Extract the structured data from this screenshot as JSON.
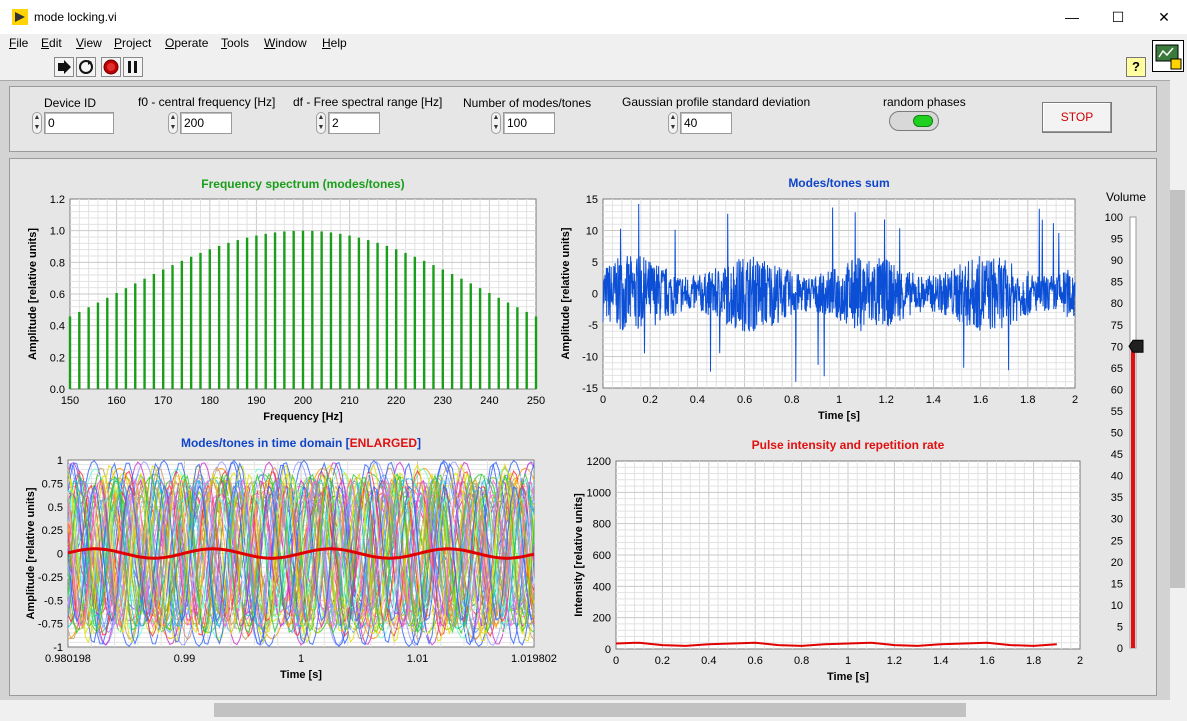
{
  "window": {
    "title": "mode locking.vi",
    "buttons": {
      "minimize": "—",
      "maximize": "☐",
      "close": "✕"
    }
  },
  "menu": {
    "items": [
      {
        "label": "File",
        "hotkey": "F",
        "rest": "ile"
      },
      {
        "label": "Edit",
        "hotkey": "E",
        "rest": "dit"
      },
      {
        "label": "View",
        "hotkey": "V",
        "rest": "iew"
      },
      {
        "label": "Project",
        "hotkey": "P",
        "rest": "roject"
      },
      {
        "label": "Operate",
        "hotkey": "O",
        "rest": "perate"
      },
      {
        "label": "Tools",
        "hotkey": "T",
        "rest": "ools"
      },
      {
        "label": "Window",
        "hotkey": "W",
        "rest": "indow"
      },
      {
        "label": "Help",
        "hotkey": "H",
        "rest": "elp"
      }
    ]
  },
  "toolbar": {
    "help_label": "?",
    "icons": [
      "run-arrow-icon",
      "run-continuously-icon",
      "abort-icon",
      "pause-icon"
    ]
  },
  "controls": {
    "device_id": {
      "label": "Device ID",
      "value": "0"
    },
    "f0": {
      "label": "f0 - central frequency [Hz]",
      "value": "200"
    },
    "df": {
      "label": "df - Free spectral range [Hz]",
      "value": "2"
    },
    "modes": {
      "label": "Number of modes/tones",
      "value": "100"
    },
    "gauss": {
      "label": "Gaussian profile standard deviation",
      "value": "40"
    },
    "random_phases": {
      "label": "random phases",
      "state": "on"
    },
    "stop_label": "STOP",
    "spinner_up": "▲",
    "spinner_down": "▼"
  },
  "colors": {
    "green": "#1a9e1a",
    "blue": "#1045c8",
    "red": "#e01010",
    "trace_blue": "#0b4fd6",
    "trace_red": "#e00000"
  },
  "chart_data": [
    {
      "id": "spectrum",
      "type": "bar",
      "title": "Frequency spectrum (modes/tones)",
      "xlabel": "Frequency [Hz]",
      "ylabel": "Amplitude [relative units]",
      "xlim": [
        150,
        250
      ],
      "ylim": [
        0,
        1.2
      ],
      "xticks": [
        "150",
        "160",
        "170",
        "180",
        "190",
        "200",
        "210",
        "220",
        "230",
        "240",
        "250"
      ],
      "yticks": [
        "0.0",
        "0.2",
        "0.4",
        "0.6",
        "0.8",
        "1.0",
        "1.2"
      ],
      "bar_color": "#1a9e1a",
      "f0": 200,
      "df": 2,
      "n_modes": 51,
      "sigma": 40,
      "grid": true
    },
    {
      "id": "sum",
      "type": "line",
      "title": "Modes/tones sum",
      "xlabel": "Time [s]",
      "ylabel": "Amplitude [relative units]",
      "xlim": [
        0,
        2
      ],
      "ylim": [
        -15,
        15
      ],
      "xticks": [
        "0",
        "0.2",
        "0.4",
        "0.6",
        "0.8",
        "1",
        "1.2",
        "1.4",
        "1.6",
        "1.8",
        "2"
      ],
      "yticks": [
        "-15",
        "-10",
        "-5",
        "0",
        "5",
        "10",
        "15"
      ],
      "line_color": "#0b4fd6",
      "grid": true
    },
    {
      "id": "time_domain",
      "type": "line",
      "title_main": "Modes/tones in time domain [",
      "title_emph": "ENLARGED",
      "title_end": "]",
      "xlabel": "Time [s]",
      "ylabel": "Amplitude [relative units]",
      "xlim": [
        0.980198,
        1.019802
      ],
      "ylim": [
        -1,
        1
      ],
      "xticks": [
        "0.980198",
        "0.99",
        "1",
        "1.01",
        "1.019802"
      ],
      "yticks": [
        "-1",
        "-0.75",
        "-0.5",
        "-0.25",
        "0",
        "0.25",
        "0.5",
        "0.75",
        "1"
      ],
      "highlight_color": "#e00000",
      "grid": true
    },
    {
      "id": "intensity",
      "type": "line",
      "title": "Pulse intensity and repetition rate",
      "xlabel": "Time [s]",
      "ylabel": "Intensity [relative units]",
      "xlim": [
        0,
        2
      ],
      "ylim": [
        0,
        1200
      ],
      "xticks": [
        "0",
        "0.2",
        "0.4",
        "0.6",
        "0.8",
        "1",
        "1.2",
        "1.4",
        "1.6",
        "1.8",
        "2"
      ],
      "yticks": [
        "0",
        "200",
        "400",
        "600",
        "800",
        "1000",
        "1200"
      ],
      "line_color": "#e00000",
      "x": [
        0,
        0.1,
        0.2,
        0.3,
        0.4,
        0.5,
        0.6,
        0.7,
        0.8,
        0.9,
        1.0,
        1.1,
        1.2,
        1.3,
        1.4,
        1.5,
        1.6,
        1.7,
        1.8,
        1.9
      ],
      "y": [
        35,
        40,
        25,
        20,
        30,
        35,
        40,
        25,
        20,
        30,
        35,
        40,
        25,
        20,
        30,
        35,
        40,
        25,
        20,
        30
      ],
      "grid": true
    }
  ],
  "volume": {
    "label": "Volume",
    "value": 70,
    "min": 0,
    "max": 100,
    "ticks": [
      "100",
      "95",
      "90",
      "85",
      "80",
      "75",
      "70",
      "65",
      "60",
      "55",
      "50",
      "45",
      "40",
      "35",
      "30",
      "25",
      "20",
      "15",
      "10",
      "5",
      "0"
    ]
  }
}
